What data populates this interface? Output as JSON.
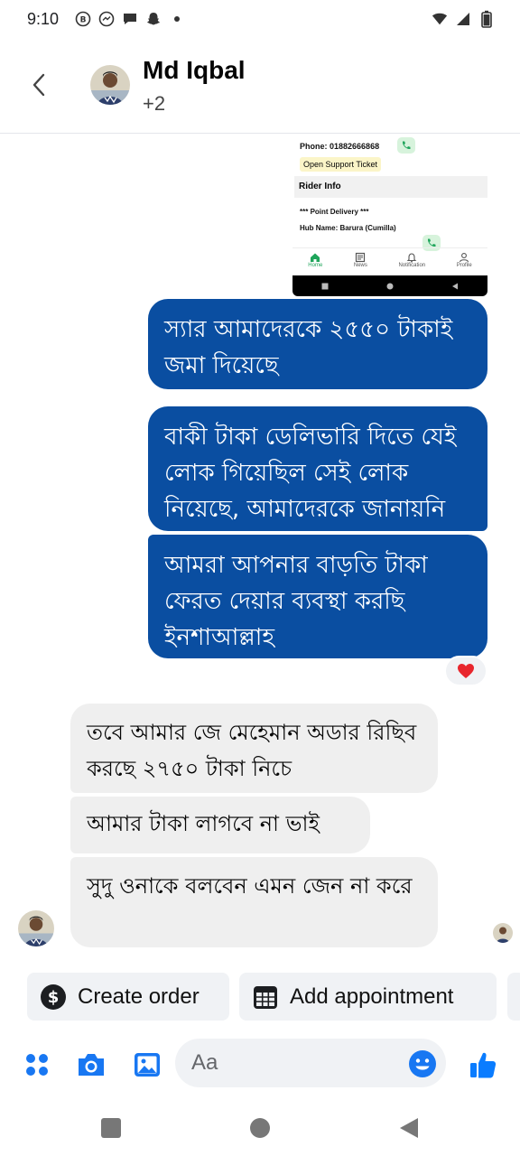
{
  "status_bar": {
    "time": "9:10",
    "notification_icons": [
      "b-circle-icon",
      "messenger-icon",
      "chat-icon",
      "snapchat-icon",
      "dot-icon"
    ],
    "system_icons": [
      "wifi-icon",
      "signal-icon",
      "battery-icon"
    ]
  },
  "header": {
    "name": "Md Iqbal",
    "subtitle": "+2",
    "back_icon": "chevron-left-icon"
  },
  "image_message": {
    "phone_label": "Phone:",
    "phone_number": "01882666868",
    "ticket_button": "Open Support Ticket",
    "section_title": "Rider Info",
    "point_delivery": "*** Point Delivery ***",
    "hub_name": "Hub Name: Barura (Cumilla)",
    "nav": [
      "Home",
      "News",
      "Notification",
      "Profile"
    ]
  },
  "messages": {
    "outgoing": [
      "স্যার আমাদেরকে ২৫৫০ টাকাই জমা দিয়েছে",
      "বাকী টাকা ডেলিভারি দিতে যেই লোক গিয়েছিল সেই লোক নিয়েছে, আমাদেরকে জানায়নি",
      "আমরা আপনার বাড়তি টাকা ফেরত দেয়ার ব্যবস্থা করছি ইনশাআল্লাহ"
    ],
    "reaction": "❤️",
    "incoming": [
      "তবে আমার  জে মেহেমান অডার রিছিব করছে ২৭৫০ টাকা নিচে",
      "আমার টাকা লাগবে না ভাই",
      "সুদু ওনাকে বলবেন এমন জেন না করে"
    ]
  },
  "quick_actions": {
    "create_order": "Create order",
    "add_appointment": "Add appointment"
  },
  "composer": {
    "placeholder": "Aa",
    "value": ""
  },
  "colors": {
    "outgoing_bubble": "#0a4ea1",
    "incoming_bubble": "#efefef",
    "messenger_blue": "#1877f2",
    "like_blue": "#0a7cff"
  }
}
